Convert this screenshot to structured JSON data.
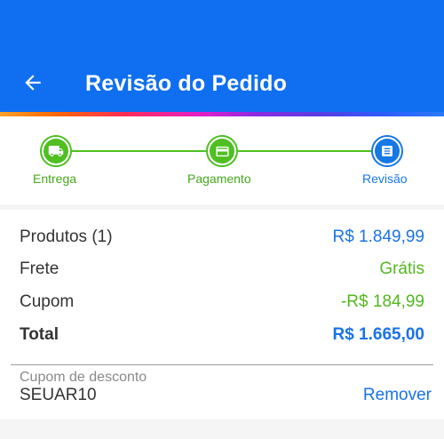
{
  "header": {
    "title": "Revisão do Pedido",
    "back_icon": "arrow-left-icon",
    "background_color": "#0f6ff0"
  },
  "steps": [
    {
      "label": "Entrega",
      "icon": "truck-icon",
      "status": "done"
    },
    {
      "label": "Pagamento",
      "icon": "credit-card-icon",
      "status": "done"
    },
    {
      "label": "Revisão",
      "icon": "list-icon",
      "status": "current"
    }
  ],
  "summary": {
    "products": {
      "label": "Produtos (1)",
      "value": "R$ 1.849,99"
    },
    "shipping": {
      "label": "Frete",
      "value": "Grátis"
    },
    "coupon": {
      "label": "Cupom",
      "value": "-R$ 184,99"
    },
    "total": {
      "label": "Total",
      "value": "R$ 1.665,00"
    }
  },
  "coupon": {
    "label": "Cupom de desconto",
    "code": "SEUAR10",
    "remove_label": "Remover"
  },
  "colors": {
    "green": "#4fbf22",
    "blue": "#1a73e8"
  }
}
